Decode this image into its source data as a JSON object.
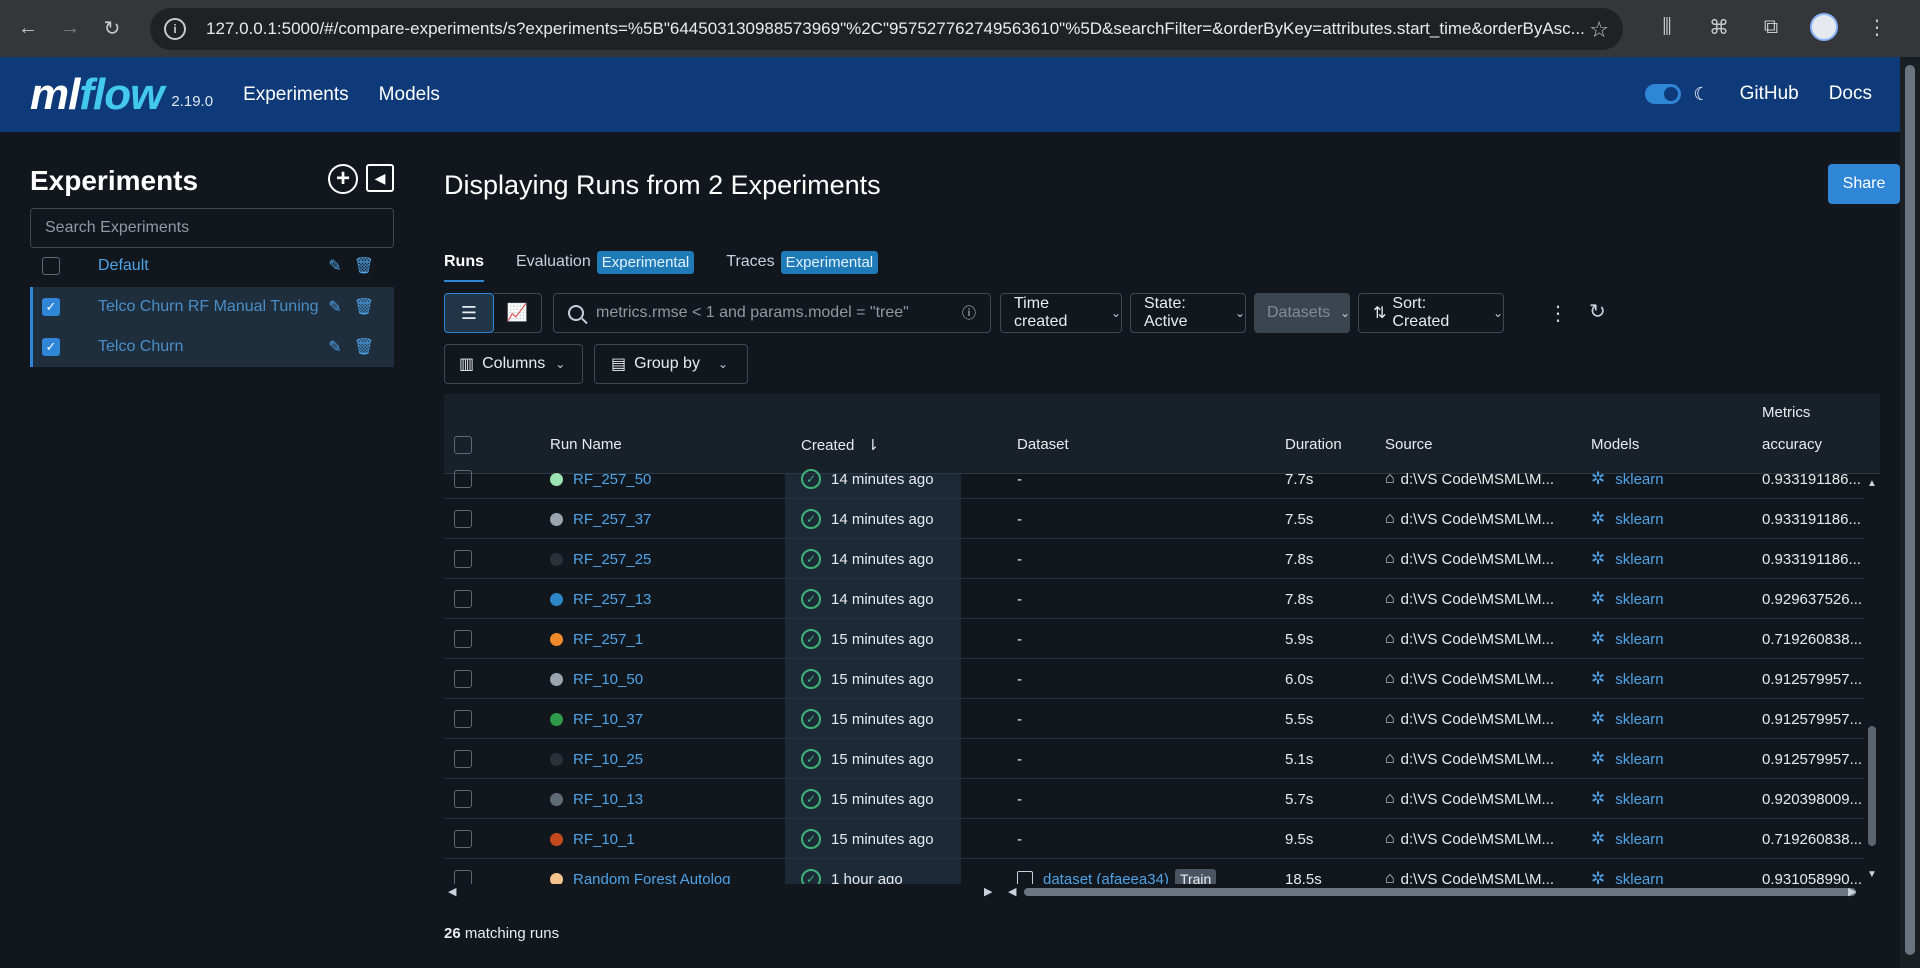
{
  "browser": {
    "url": "127.0.0.1:5000/#/compare-experiments/s?experiments=%5B\"644503130988573969\"%2C\"957527762749563610\"%5D&searchFilter=&orderByKey=attributes.start_time&orderByAsc..."
  },
  "header": {
    "logo_ml": "ml",
    "logo_flow": "flow",
    "version": "2.19.0",
    "nav": [
      "Experiments",
      "Models"
    ],
    "github": "GitHub",
    "docs": "Docs"
  },
  "sidebar": {
    "title": "Experiments",
    "search_placeholder": "Search Experiments",
    "experiments": [
      {
        "name": "Default",
        "checked": false
      },
      {
        "name": "Telco Churn RF Manual Tuning",
        "checked": true
      },
      {
        "name": "Telco Churn",
        "checked": true
      }
    ]
  },
  "main": {
    "title": "Displaying Runs from 2 Experiments",
    "share": "Share",
    "tabs": [
      {
        "label": "Runs",
        "badge": ""
      },
      {
        "label": "Evaluation",
        "badge": "Experimental"
      },
      {
        "label": "Traces",
        "badge": "Experimental"
      }
    ],
    "search_placeholder": "metrics.rmse < 1 and params.model = \"tree\"",
    "time_created": "Time created",
    "state": "State: Active",
    "datasets": "Datasets",
    "sort": "Sort: Created",
    "columns": "Columns",
    "group_by": "Group by"
  },
  "table": {
    "group_header": "Metrics",
    "columns": [
      "Run Name",
      "Created",
      "Dataset",
      "Duration",
      "Source",
      "Models",
      "accuracy"
    ],
    "rows": [
      {
        "name": "RF_257_50",
        "color": "#9be3b0",
        "created": "14 minutes ago",
        "dataset": "-",
        "duration": "7.7s",
        "source": "d:\\VS Code\\MSML\\M...",
        "model": "sklearn",
        "accuracy": "0.933191186..."
      },
      {
        "name": "RF_257_37",
        "color": "#9aa4ae",
        "created": "14 minutes ago",
        "dataset": "-",
        "duration": "7.5s",
        "source": "d:\\VS Code\\MSML\\M...",
        "model": "sklearn",
        "accuracy": "0.933191186..."
      },
      {
        "name": "RF_257_25",
        "color": "#2a3138",
        "created": "14 minutes ago",
        "dataset": "-",
        "duration": "7.8s",
        "source": "d:\\VS Code\\MSML\\M...",
        "model": "sklearn",
        "accuracy": "0.933191186..."
      },
      {
        "name": "RF_257_13",
        "color": "#2e86c9",
        "created": "14 minutes ago",
        "dataset": "-",
        "duration": "7.8s",
        "source": "d:\\VS Code\\MSML\\M...",
        "model": "sklearn",
        "accuracy": "0.929637526..."
      },
      {
        "name": "RF_257_1",
        "color": "#ee8a2a",
        "created": "15 minutes ago",
        "dataset": "-",
        "duration": "5.9s",
        "source": "d:\\VS Code\\MSML\\M...",
        "model": "sklearn",
        "accuracy": "0.719260838..."
      },
      {
        "name": "RF_10_50",
        "color": "#9aa4ae",
        "created": "15 minutes ago",
        "dataset": "-",
        "duration": "6.0s",
        "source": "d:\\VS Code\\MSML\\M...",
        "model": "sklearn",
        "accuracy": "0.912579957..."
      },
      {
        "name": "RF_10_37",
        "color": "#2e9a4a",
        "created": "15 minutes ago",
        "dataset": "-",
        "duration": "5.5s",
        "source": "d:\\VS Code\\MSML\\M...",
        "model": "sklearn",
        "accuracy": "0.912579957..."
      },
      {
        "name": "RF_10_25",
        "color": "#2a3138",
        "created": "15 minutes ago",
        "dataset": "-",
        "duration": "5.1s",
        "source": "d:\\VS Code\\MSML\\M...",
        "model": "sklearn",
        "accuracy": "0.912579957..."
      },
      {
        "name": "RF_10_13",
        "color": "#5f6b75",
        "created": "15 minutes ago",
        "dataset": "-",
        "duration": "5.7s",
        "source": "d:\\VS Code\\MSML\\M...",
        "model": "sklearn",
        "accuracy": "0.920398009..."
      },
      {
        "name": "RF_10_1",
        "color": "#c24a1e",
        "created": "15 minutes ago",
        "dataset": "-",
        "duration": "9.5s",
        "source": "d:\\VS Code\\MSML\\M...",
        "model": "sklearn",
        "accuracy": "0.719260838..."
      },
      {
        "name": "Random Forest Autolog",
        "color": "#f4c28c",
        "created": "1 hour ago",
        "dataset": "dataset (afaeea34)",
        "dataset_badge": "Train",
        "duration": "18.5s",
        "source": "d:\\VS Code\\MSML\\M...",
        "model": "sklearn",
        "accuracy": "0.931058990..."
      }
    ]
  },
  "footer": {
    "match_count": "26",
    "match_label": "matching runs"
  }
}
